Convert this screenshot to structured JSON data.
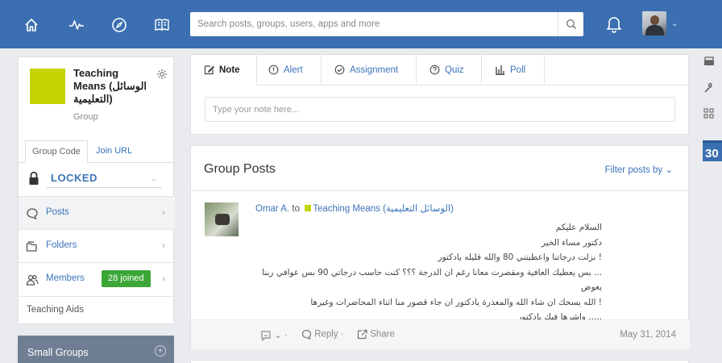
{
  "topbar": {
    "search_placeholder": "Search posts, groups, users, apps and more"
  },
  "group": {
    "name": "Teaching Means (الوسائل التعليمية)",
    "type": "Group",
    "thumb_color": "#c5d400",
    "tabs": [
      "Group Code",
      "Join URL"
    ],
    "lock_status": "LOCKED",
    "nav": [
      {
        "label": "Posts",
        "icon": "posts-icon"
      },
      {
        "label": "Folders",
        "icon": "folder-icon"
      },
      {
        "label": "Members",
        "icon": "members-icon",
        "badge": "28 joined"
      }
    ],
    "teaching_aids": "Teaching Aids"
  },
  "small_groups": {
    "label": "Small Groups"
  },
  "composer": {
    "tabs": [
      {
        "label": "Note",
        "icon": "note-icon"
      },
      {
        "label": "Alert",
        "icon": "alert-icon"
      },
      {
        "label": "Assignment",
        "icon": "assignment-icon"
      },
      {
        "label": "Quiz",
        "icon": "quiz-icon"
      },
      {
        "label": "Poll",
        "icon": "poll-icon"
      }
    ],
    "placeholder": "Type your note here..."
  },
  "posts": {
    "title": "Group Posts",
    "filter_label": "Filter posts by",
    "items": [
      {
        "author": "Omar A.",
        "to": "to",
        "group": "Teaching Means (الوسائل التعليمية)",
        "lines": [
          "السلام عليكم",
          "دكتور مساء الخير",
          "! نزلت درجاتنا واعطيتني 80 والله قليله يادكتور",
          "... بس يعطيك العافية ومقصرت معانا رغم ان الدرجة ؟؟؟ كنت حاسب درجاتي 90 بس عوافي ربنا يعوض",
          "! الله يسحك ان شاء الله والمعذرة يادكتور ان جاء قصور منا اثناء المحاضرات وغيرها",
          "..... واشرها فيك يادكتور"
        ],
        "reply_label": "Reply",
        "share_label": "Share",
        "date": "May 31, 2014"
      }
    ]
  },
  "colors": {
    "topbar": "#3b6fb1",
    "link": "#3b73b9",
    "badge_green": "#3ca637"
  },
  "rail": {
    "calendar_day": "30"
  }
}
